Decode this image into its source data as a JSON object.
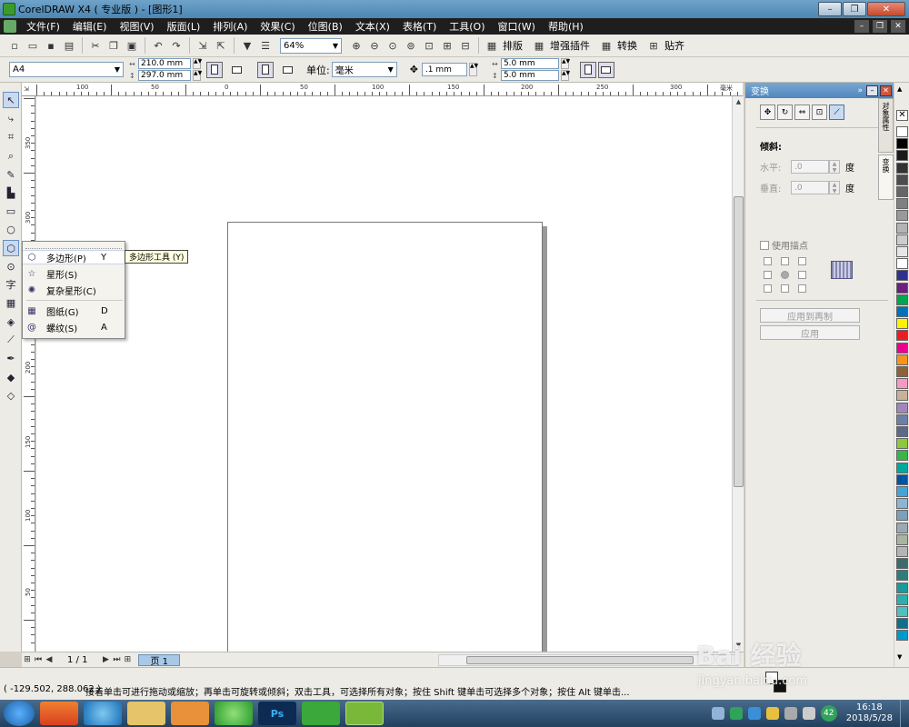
{
  "window": {
    "title": "CorelDRAW X4 ( 专业版 ) - [图形1]",
    "minimize": "–",
    "restore": "❐",
    "close": "✕"
  },
  "menu": {
    "items": [
      "文件(F)",
      "编辑(E)",
      "视图(V)",
      "版面(L)",
      "排列(A)",
      "效果(C)",
      "位图(B)",
      "文本(X)",
      "表格(T)",
      "工具(O)",
      "窗口(W)",
      "帮助(H)"
    ],
    "doc_min": "–",
    "doc_restore": "❐",
    "doc_close": "✕"
  },
  "toolbar": {
    "zoom": "64%",
    "layout_label": "排版",
    "plugin_label": "增强插件",
    "convert_label": "转换",
    "paste_label": "贴齐"
  },
  "property_bar": {
    "page_size": "A4",
    "width": "210.0 mm",
    "height": "297.0 mm",
    "unit_label": "单位:",
    "unit": "毫米",
    "nudge": ".1 mm",
    "dup_x": "5.0 mm",
    "dup_y": "5.0 mm"
  },
  "rulers": {
    "unit_top": "毫米",
    "top_labels": [
      "100",
      "50",
      "0",
      "50",
      "100",
      "150",
      "200",
      "250",
      "300"
    ],
    "left_labels": [
      "350",
      "300",
      "250",
      "200",
      "150",
      "100",
      "50"
    ]
  },
  "flyout": {
    "items": [
      {
        "label": "多边形(P)",
        "key": "Y"
      },
      {
        "label": "星形(S)",
        "key": ""
      },
      {
        "label": "复杂星形(C)",
        "key": ""
      },
      {
        "label": "图纸(G)",
        "key": "D"
      },
      {
        "label": "螺纹(S)",
        "key": "A"
      }
    ],
    "tooltip": "多边形工具 (Y)"
  },
  "pagebar": {
    "count": "1 / 1",
    "tab": "页 1"
  },
  "docker": {
    "title": "变换",
    "skew_label": "倾斜:",
    "horizontal_label": "水平:",
    "horizontal_value": ".0",
    "vertical_label": "垂直:",
    "vertical_value": ".0",
    "degree": "度",
    "anchor_label": "使用描点",
    "apply_dup": "应用到再制",
    "apply": "应用",
    "side_tab_1": "对象属性",
    "side_tab_2": "变换"
  },
  "palette": {
    "colors": [
      "#ffffff",
      "#000000",
      "#1a1a1a",
      "#333333",
      "#4d4d4d",
      "#666666",
      "#808080",
      "#999999",
      "#b3b3b3",
      "#cccccc",
      "#e6e6e6",
      "#ffffff",
      "#2e3192",
      "#6d1f7e",
      "#00a651",
      "#0072bc",
      "#fff200",
      "#ed1c24",
      "#ec008c",
      "#f7941d",
      "#8c6239",
      "#f49ac2",
      "#c7b299",
      "#a186be",
      "#6c7fa6",
      "#5b6a8a",
      "#8dc63f",
      "#39b54a",
      "#00a99d",
      "#0054a6",
      "#44a4d8",
      "#8ab6d4",
      "#7d9fb8",
      "#9aa9b5",
      "#a8b4a0",
      "#b4b4b4",
      "#3d6b6b",
      "#2e7d7d",
      "#1a9a9a",
      "#2ab0b0",
      "#4fbfbf",
      "#0f6f8f",
      "#0099cc"
    ]
  },
  "status": {
    "coords": "( -129.502, 288.062 )",
    "hint": "接着单击可进行拖动或缩放；再单击可旋转或倾斜；双击工具，可选择所有对象；按住 Shift 键单击可选择多个对象；按住 Alt 键单击..."
  },
  "taskbar": {
    "apps": [
      "",
      "",
      "",
      "",
      "",
      "Ps",
      "",
      ""
    ],
    "time": "16:18",
    "date": "2018/5/28",
    "badge": "42"
  },
  "watermark": {
    "text": "Bai 经验",
    "url": "jingyan.baidu.com"
  }
}
